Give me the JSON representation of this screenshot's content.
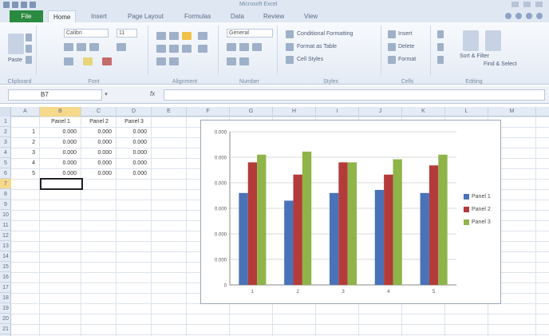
{
  "app": {
    "window_title": "Microsoft Excel"
  },
  "tabs": {
    "file": "File",
    "items": [
      "Home",
      "Insert",
      "Page Layout",
      "Formulas",
      "Data",
      "Review",
      "View"
    ],
    "active_index": 0
  },
  "ribbon": {
    "clipboard": {
      "label": "Clipboard",
      "paste": "Paste"
    },
    "font": {
      "label": "Font",
      "name": "Calibri",
      "size": "11"
    },
    "alignment": {
      "label": "Alignment"
    },
    "number": {
      "label": "Number",
      "format": "General"
    },
    "styles": {
      "label": "Styles",
      "conditional": "Conditional Formatting",
      "format_table": "Format as Table",
      "cell_styles": "Cell Styles"
    },
    "cells": {
      "label": "Cells",
      "insert": "Insert",
      "delete": "Delete",
      "format": "Format"
    },
    "editing": {
      "label": "Editing",
      "sort": "Sort & Filter",
      "find": "Find & Select"
    }
  },
  "formula_bar": {
    "name_box": "B7",
    "fx": "fx",
    "value": ""
  },
  "grid": {
    "columns": [
      "A",
      "B",
      "C",
      "D",
      "E",
      "F",
      "G",
      "H",
      "I",
      "J",
      "K",
      "L",
      "M"
    ],
    "selected_column": "B",
    "rows": [
      "1",
      "2",
      "3",
      "4",
      "5",
      "6",
      "7",
      "8",
      "9",
      "10",
      "11",
      "12",
      "13",
      "14",
      "15",
      "16",
      "17",
      "18",
      "19",
      "20",
      "21"
    ],
    "selected_row": "7",
    "headers": [
      "Panel 1",
      "Panel 2",
      "Panel 3"
    ],
    "row_numbers": [
      "1",
      "2",
      "3",
      "4",
      "5"
    ],
    "values": [
      [
        "0.000",
        "0.000",
        "0.000"
      ],
      [
        "0.000",
        "0.000",
        "0.000"
      ],
      [
        "0.000",
        "0.000",
        "0.000"
      ],
      [
        "0.000",
        "0.000",
        "0.000"
      ],
      [
        "0.000",
        "0.000",
        "0.000"
      ]
    ]
  },
  "chart_data": {
    "type": "bar",
    "categories": [
      "1",
      "2",
      "3",
      "4",
      "5"
    ],
    "series": [
      {
        "name": "Panel 1",
        "color": "#4a72b8",
        "values": [
          0.6,
          0.55,
          0.6,
          0.62,
          0.6
        ]
      },
      {
        "name": "Panel 2",
        "color": "#b33c3a",
        "values": [
          0.8,
          0.72,
          0.8,
          0.72,
          0.78
        ]
      },
      {
        "name": "Panel 3",
        "color": "#8fb44a",
        "values": [
          0.85,
          0.87,
          0.8,
          0.82,
          0.85
        ]
      }
    ],
    "ylim": [
      0,
      1
    ],
    "y_ticks": [
      "0",
      "0.000",
      "0.000",
      "0.000",
      "0.000",
      "0.000",
      "0.000"
    ],
    "grid": true,
    "legend": "right",
    "title": "",
    "xlabel": "",
    "ylabel": ""
  }
}
